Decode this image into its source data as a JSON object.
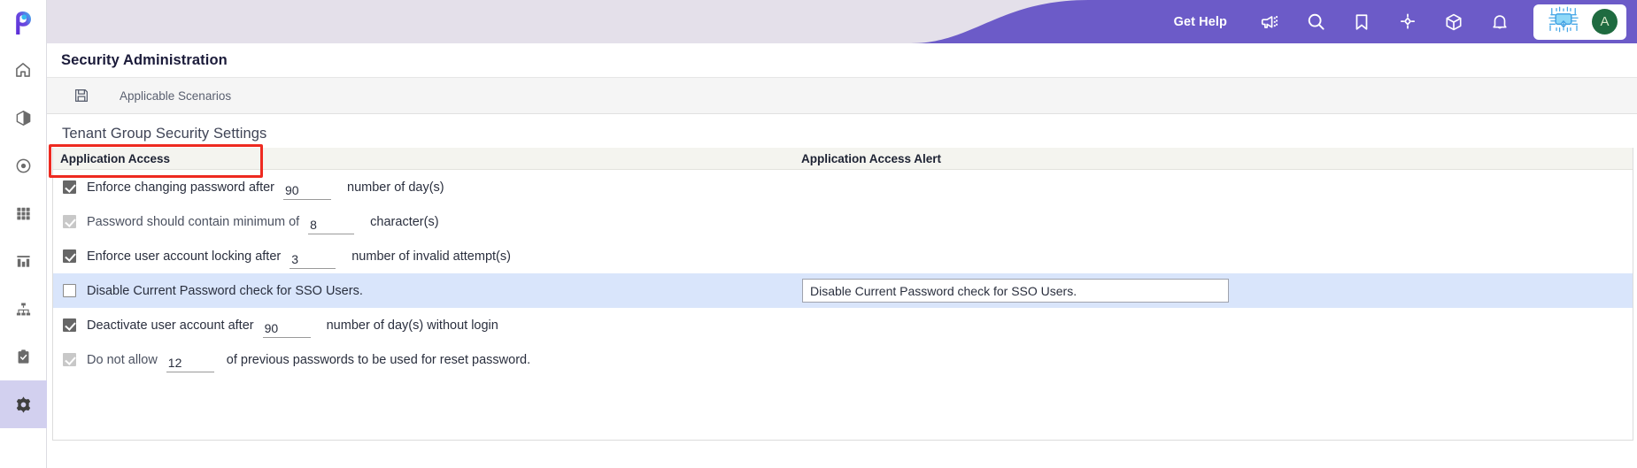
{
  "app": {
    "logo": "paligo-p-logo",
    "brand_purple": "#6c5bc8",
    "topbar_lavender": "#e4e0ea",
    "highlight_row": "#d9e5fb",
    "annotation_red": "#ee2a20"
  },
  "sidebar": {
    "items": [
      {
        "icon": "home-icon",
        "name": "home",
        "active": false
      },
      {
        "icon": "cube-icon",
        "name": "models",
        "active": false
      },
      {
        "icon": "target-icon",
        "name": "targets",
        "active": false
      },
      {
        "icon": "grid-icon",
        "name": "grid",
        "active": false
      },
      {
        "icon": "bar-chart-icon",
        "name": "reports",
        "active": false
      },
      {
        "icon": "hierarchy-icon",
        "name": "hierarchy",
        "active": false
      },
      {
        "icon": "clipboard-check-icon",
        "name": "tasks",
        "active": false
      },
      {
        "icon": "gear-icon",
        "name": "administration",
        "active": true
      }
    ]
  },
  "topbar": {
    "get_help_label": "Get Help",
    "icons": [
      {
        "name": "announcement-icon",
        "glyph": "megaphone"
      },
      {
        "name": "search-icon",
        "glyph": "magnifier"
      },
      {
        "name": "bookmark-icon",
        "glyph": "bookmark"
      },
      {
        "name": "focus-icon",
        "glyph": "crosshair"
      },
      {
        "name": "package-icon",
        "glyph": "cube"
      },
      {
        "name": "notifications-icon",
        "glyph": "bell"
      }
    ],
    "ai_assistant_icon": "ai-chip-icon",
    "avatar_initial": "A"
  },
  "page": {
    "title": "Security Administration"
  },
  "toolbar": {
    "save_icon": "save-floppy-icon",
    "applicable_scenarios_label": "Applicable Scenarios"
  },
  "section": {
    "title": "Tenant Group Security Settings"
  },
  "table": {
    "headers": {
      "col1": "Application Access",
      "col2": "Application Access Alert"
    },
    "rows": [
      {
        "checked": true,
        "dim": false,
        "highlight": false,
        "label_before": "Enforce changing password after",
        "value": "90",
        "label_after": "number of day(s)",
        "has_input": true,
        "alert_value": ""
      },
      {
        "checked": true,
        "dim": true,
        "highlight": false,
        "label_before": "Password should contain minimum of",
        "value": "8",
        "label_after": "character(s)",
        "has_input": true,
        "alert_value": ""
      },
      {
        "checked": true,
        "dim": false,
        "highlight": false,
        "label_before": "Enforce user account locking after",
        "value": "3",
        "label_after": "number of invalid attempt(s)",
        "has_input": true,
        "alert_value": ""
      },
      {
        "checked": false,
        "dim": false,
        "highlight": true,
        "label_before": "Disable Current Password check for SSO Users.",
        "value": "",
        "label_after": "",
        "has_input": false,
        "alert_value": "Disable Current Password check for SSO Users."
      },
      {
        "checked": true,
        "dim": false,
        "highlight": false,
        "label_before": "Deactivate user account after",
        "value": "90",
        "label_after": "number of day(s) without login",
        "has_input": true,
        "alert_value": ""
      },
      {
        "checked": true,
        "dim": true,
        "highlight": false,
        "label_before": "Do not allow",
        "value": "12",
        "label_after": "of previous passwords to be used for reset password.",
        "has_input": true,
        "alert_value": ""
      }
    ]
  }
}
